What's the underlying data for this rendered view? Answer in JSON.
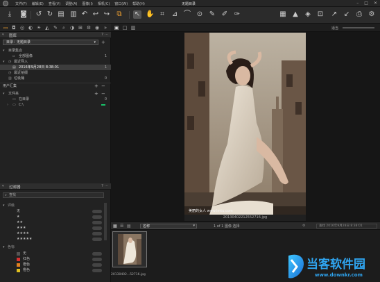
{
  "menubar": {
    "items": [
      "文件(F)",
      "编辑(E)",
      "查看(V)",
      "调整(A)",
      "图像(I)",
      "相机(C)",
      "窗口(W)",
      "帮助(H)"
    ],
    "title": "无题目录",
    "window_controls": [
      "–",
      "□",
      "✕"
    ]
  },
  "left_panel": {
    "library_header": "图库",
    "catalog_selector": "目录：无题目录",
    "catalog_collection_header": "目录集合",
    "rows": [
      {
        "label": "全部图像",
        "count": "1"
      },
      {
        "label": "最近导入",
        "count": ""
      },
      {
        "label": "2016年9月28日 8:38:01",
        "count": "1"
      },
      {
        "label": "最近拍摄",
        "count": ""
      },
      {
        "label": "垃圾桶",
        "count": "0"
      }
    ],
    "user_collections_header": "用户汇集",
    "folders_header": "文件夹",
    "folder_rows": [
      {
        "label": "在目录",
        "count": "0"
      },
      {
        "label": "C:\\",
        "count": ""
      }
    ],
    "filter_header": "过滤器",
    "search_placeholder": "查找",
    "rating_header": "评级",
    "ratings": [
      "无",
      "★",
      "★★",
      "★★★",
      "★★★★",
      "★★★★★"
    ],
    "color_header": "色标",
    "colors": [
      {
        "label": "无",
        "color": "#555555"
      },
      {
        "label": "红色",
        "color": "#d83030"
      },
      {
        "label": "橙色",
        "color": "#e08020"
      },
      {
        "label": "橙色",
        "color": "#e0c020"
      }
    ]
  },
  "viewer": {
    "top_right_label": "适当",
    "photo_caption": "20130402212552716.jpg",
    "photo_watermark_text": "美丽的女人 www.lmtu.com"
  },
  "browser": {
    "sort_label": "名称",
    "status": "1 of 1 图像 选择",
    "search_placeholder": "查找 2016年9月28日 8:38:01",
    "thumb_label": "20130402...52716.jpg"
  },
  "watermark": {
    "brand": "当客软件园",
    "url": "www.downkr.com"
  }
}
